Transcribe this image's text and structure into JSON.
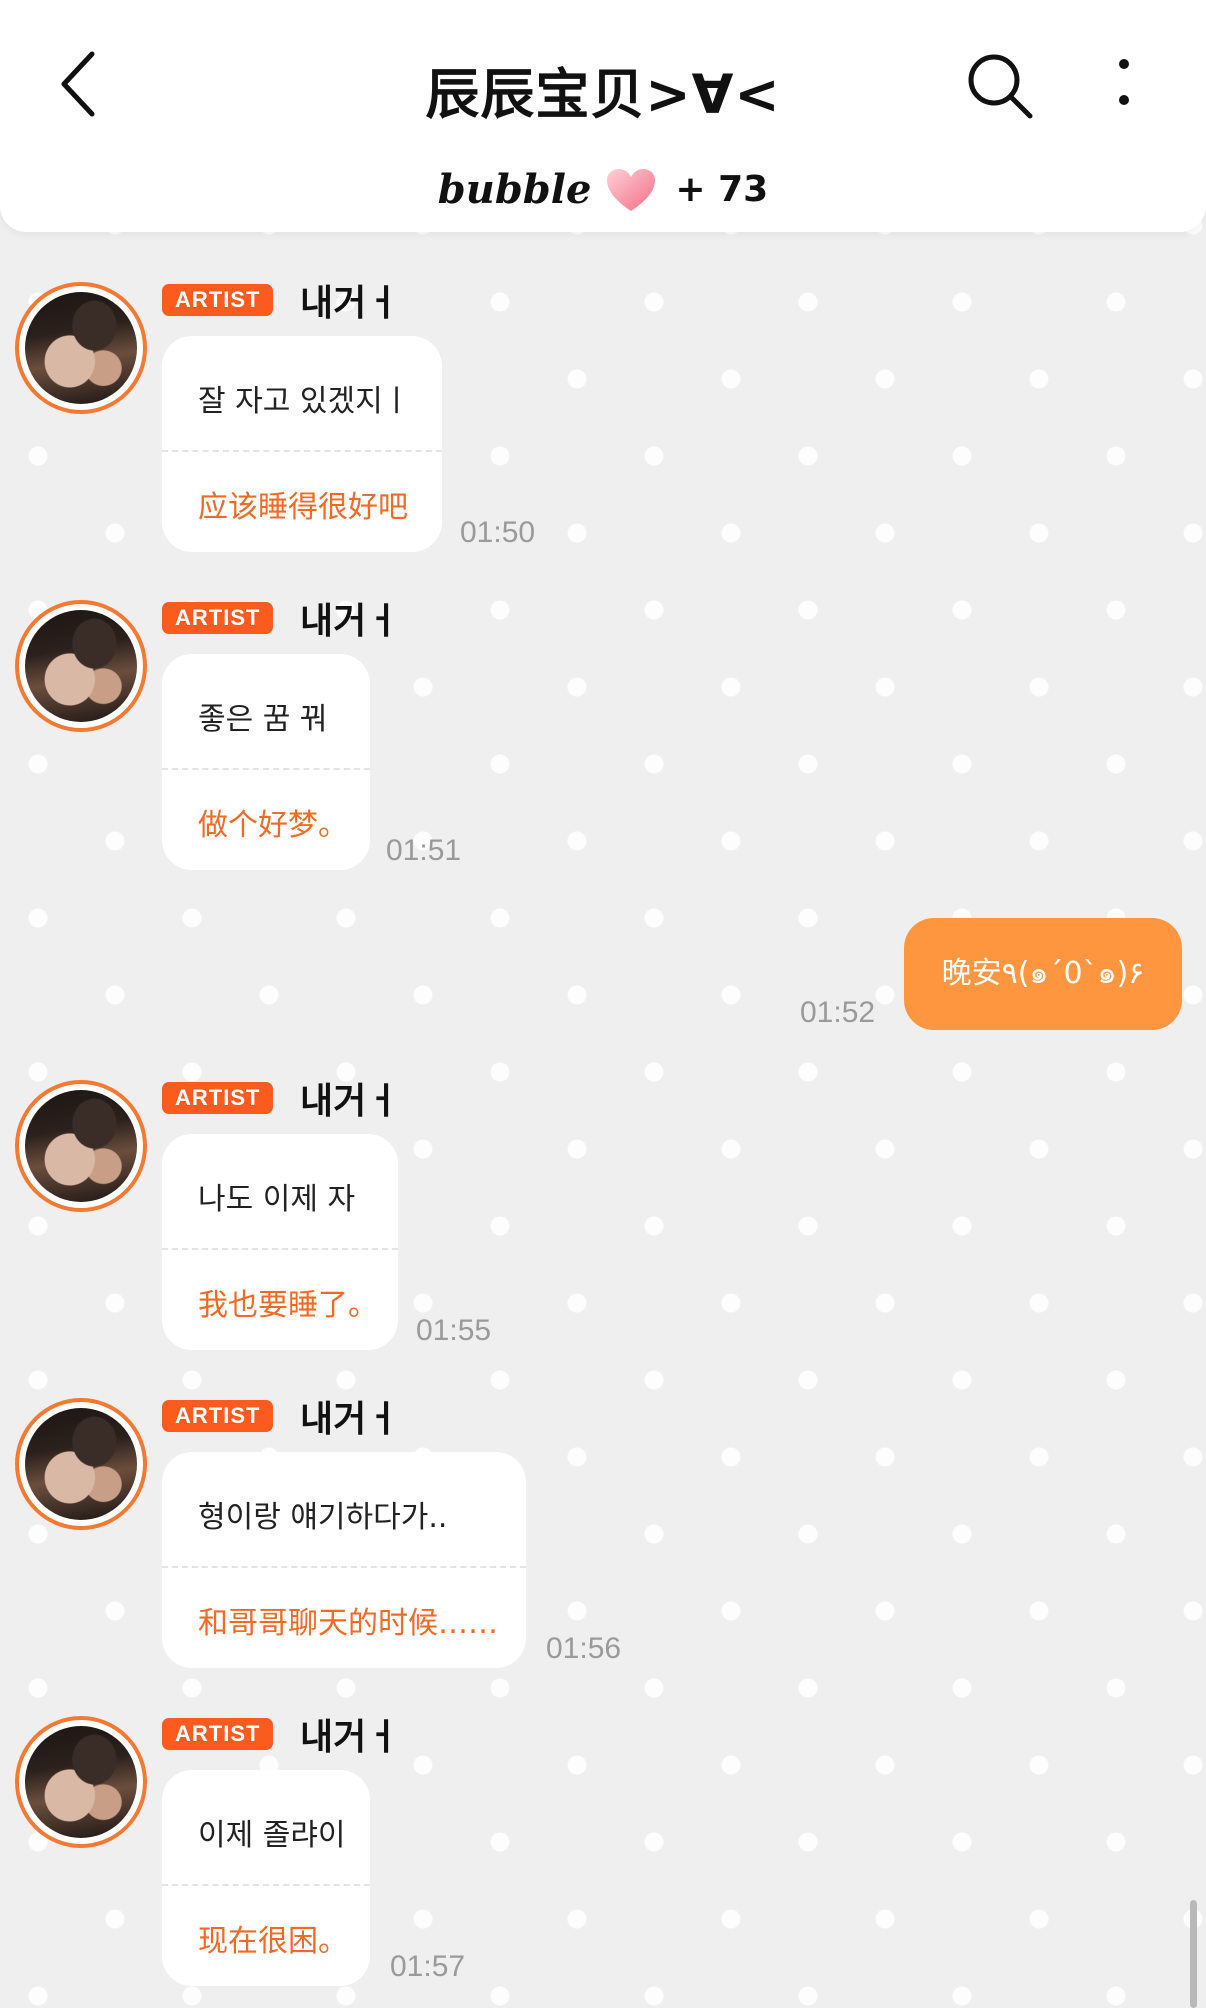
{
  "header": {
    "title": "辰辰宝贝>∀<",
    "bubble_label": "bubble",
    "bubble_count": "+ 73"
  },
  "messages": [
    {
      "badge": "ARTIST",
      "sender": "내거ㅓ",
      "korean": "잘 자고 있겠지ㅣ",
      "chinese": "应该睡得很好吧",
      "time": "01:50"
    },
    {
      "badge": "ARTIST",
      "sender": "내거ㅓ",
      "korean": "좋은 꿈 꿔",
      "chinese": "做个好梦。",
      "time": "01:51"
    },
    {
      "badge": "ARTIST",
      "sender": "내거ㅓ",
      "korean": "나도 이제 자",
      "chinese": "我也要睡了。",
      "time": "01:55"
    },
    {
      "badge": "ARTIST",
      "sender": "내거ㅓ",
      "korean": "형이랑 얘기하다가..",
      "chinese": "和哥哥聊天的时候……",
      "time": "01:56"
    },
    {
      "badge": "ARTIST",
      "sender": "내거ㅓ",
      "korean": "이제 졸랴이",
      "chinese": "现在很困。",
      "time": "01:57"
    }
  ],
  "user_message": {
    "text": "晚安٩(๑´0`๑)۶",
    "time": "01:52"
  },
  "colors": {
    "accent": "#fb5b1e",
    "translation": "#f26a23",
    "user_bubble": "#fe963f",
    "background": "#efefef"
  },
  "icons": [
    "back-icon",
    "search-icon",
    "more-icon",
    "heart-icon"
  ]
}
